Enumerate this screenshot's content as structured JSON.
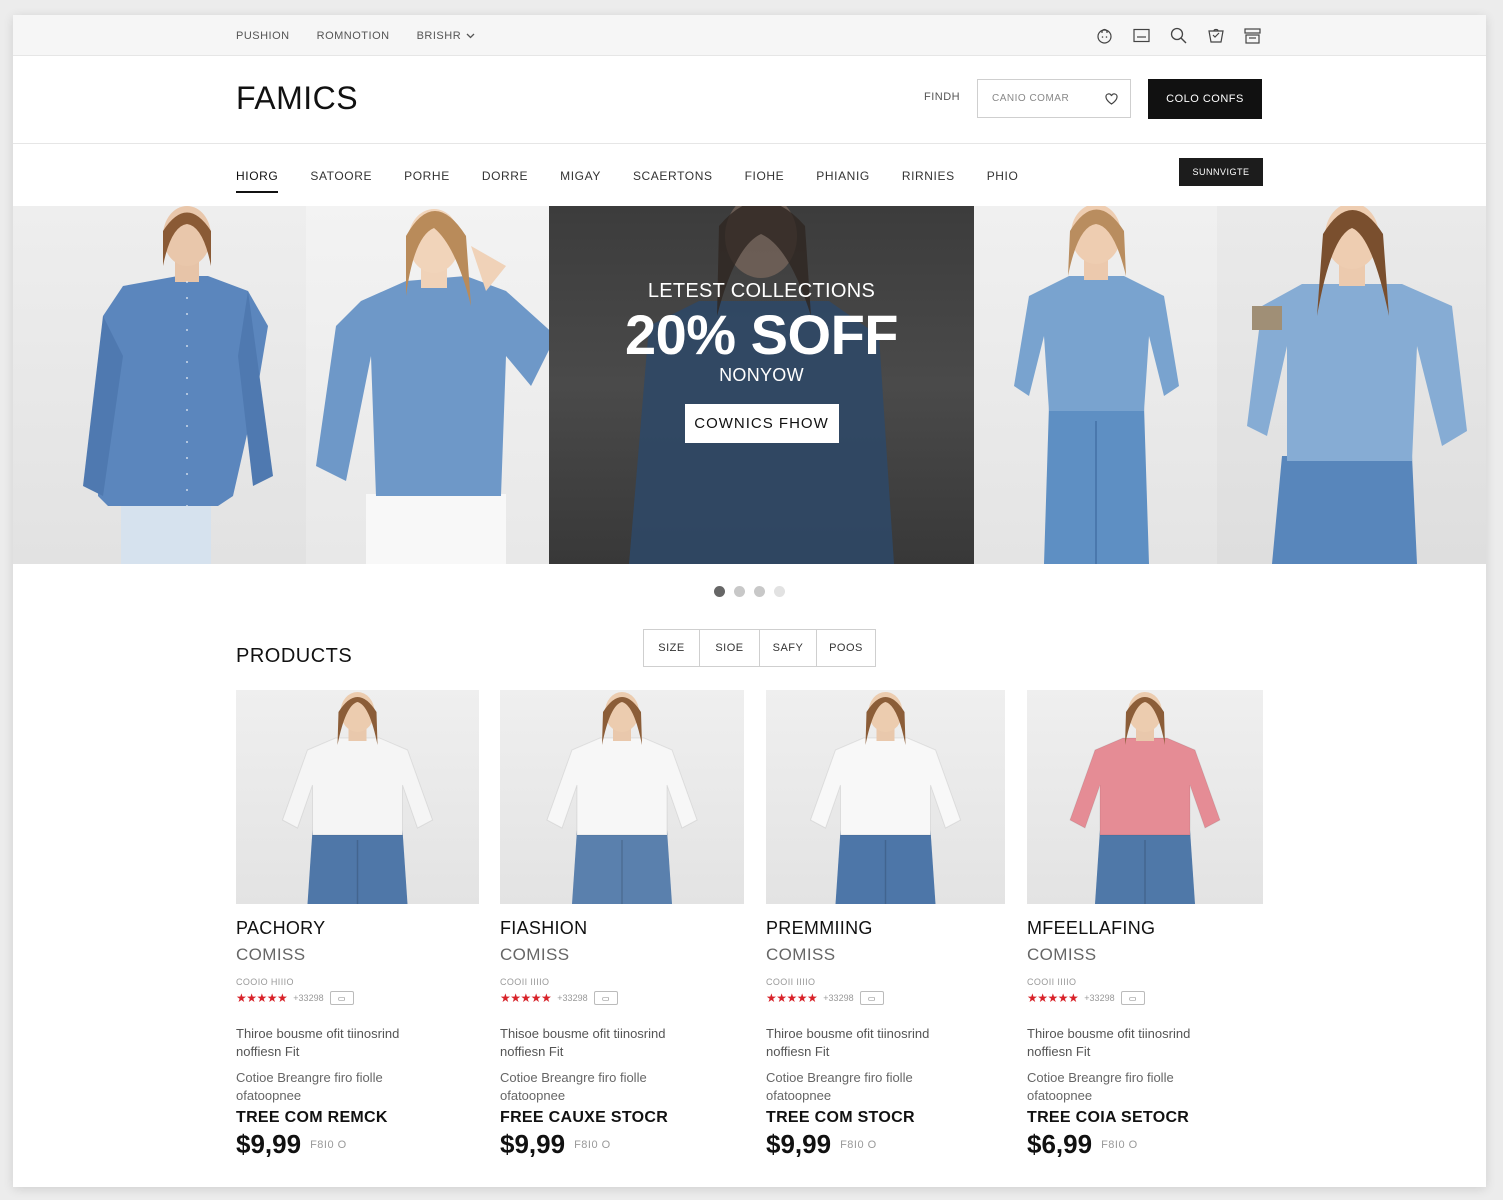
{
  "utility": {
    "links": [
      "PUSHION",
      "ROMNOTION",
      "BRISHR"
    ],
    "icons": [
      "bag-icon",
      "window-icon",
      "search-icon",
      "gift-icon",
      "tray-icon"
    ]
  },
  "header": {
    "logo": "FAMICS",
    "find_label": "FINDH",
    "search_placeholder": "CANIO COMAR",
    "cta_label": "COLO CONFS"
  },
  "nav": {
    "items": [
      "HIORG",
      "SATOORE",
      "PORHE",
      "DORRE",
      "MIGAY",
      "SCAERTONS",
      "FIOHE",
      "PHIANIG",
      "RIRNIES",
      "PHIO"
    ],
    "active_index": 0,
    "subscribe_label": "SUNNVIGTE"
  },
  "hero": {
    "kicker": "LETEST COLLECTIONS",
    "headline": "20% SOFF",
    "subline": "NONYOW",
    "button_label": "COWNICS FHOW",
    "slides": 4,
    "active_slide": 0
  },
  "products": {
    "title": "PRODUCTS",
    "filters": [
      "SIZE",
      "SIOE",
      "SAFY",
      "POOS"
    ],
    "items": [
      {
        "name": "PACHORY",
        "brand": "COMISS",
        "sku": "COOIO HIIIO",
        "stars": "★★★★★",
        "reviews": "+33298",
        "desc": "Thiroe bousme ofit tiinosrind noffiesn Fit",
        "fit": "Cotioe Breangre firo fiolle ofatoopnee",
        "ship": "TREE COM REMCK",
        "price": "$9,99",
        "old_price": "F8I0 O",
        "top_color": "#f5f5f5",
        "bottom_color": "#4f77a8"
      },
      {
        "name": "FIASHION",
        "brand": "COMISS",
        "sku": "COOII IIIIO",
        "stars": "★★★★★",
        "reviews": "+33298",
        "desc": "Thisoe bousme ofit tiinosrind noffiesn Fit",
        "fit": "Cotioe Breangre firo fiolle ofatoopnee",
        "ship": "FREE CAUXE STOCR",
        "price": "$9,99",
        "old_price": "F8I0 O",
        "top_color": "#f7f7f7",
        "bottom_color": "#5a80ad"
      },
      {
        "name": "PREMMIING",
        "brand": "COMISS",
        "sku": "COOII IIIIO",
        "stars": "★★★★★",
        "reviews": "+33298",
        "desc": "Thiroe bousme ofit tiinosrind noffiesn Fit",
        "fit": "Cotioe Breangre firo fiolle ofatoopnee",
        "ship": "TREE COM STOCR",
        "price": "$9,99",
        "old_price": "F8I0 O",
        "top_color": "#f8f8f8",
        "bottom_color": "#4d76a8"
      },
      {
        "name": "MFEELLAFING",
        "brand": "COMISS",
        "sku": "COOII IIIIO",
        "stars": "★★★★★",
        "reviews": "+33298",
        "desc": "Thiroe bousme ofit tiinosrind noffiesn Fit",
        "fit": "Cotioe Breangre firo fiolle ofatoopnee",
        "ship": "TREE COIA SETOCR",
        "price": "$6,99",
        "old_price": "F8I0 O",
        "top_color": "#e58c95",
        "bottom_color": "#4f78a8"
      }
    ]
  },
  "colors": {
    "accent_dark": "#111111",
    "star_red": "#d8232a",
    "denim": "#5b86bd"
  }
}
